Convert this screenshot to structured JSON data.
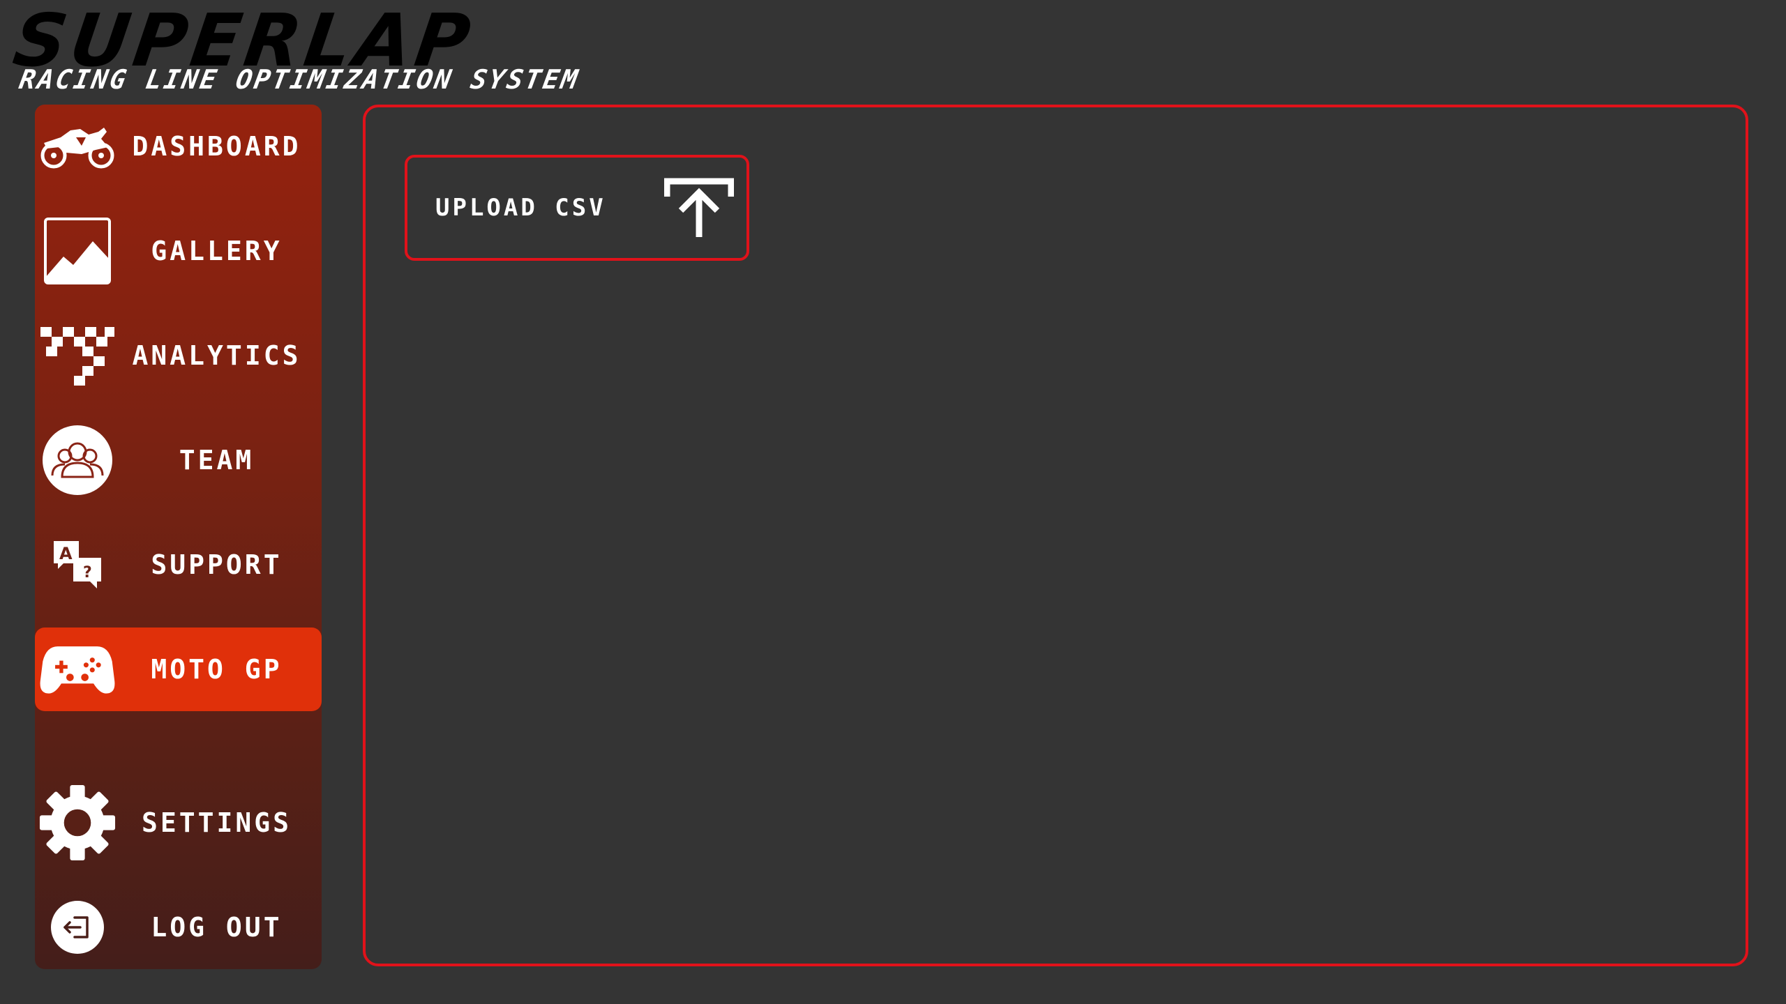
{
  "header": {
    "title": "SUPERLAP",
    "subtitle": "RACING LINE OPTIMIZATION SYSTEM"
  },
  "sidebar": {
    "items": [
      {
        "label": "DASHBOARD",
        "icon": "motorcycle-icon"
      },
      {
        "label": "GALLERY",
        "icon": "image-icon"
      },
      {
        "label": "ANALYTICS",
        "icon": "checkered-flag-icon"
      },
      {
        "label": "TEAM",
        "icon": "team-icon"
      },
      {
        "label": "SUPPORT",
        "icon": "translate-chat-icon"
      },
      {
        "label": "MOTO GP",
        "icon": "gamepad-icon",
        "active": true
      },
      {
        "label": "SETTINGS",
        "icon": "gear-icon"
      },
      {
        "label": "LOG OUT",
        "icon": "logout-icon"
      }
    ]
  },
  "main": {
    "upload_label": "UPLOAD CSV",
    "upload_icon": "upload-icon"
  },
  "colors": {
    "background": "#343434",
    "accent_red": "#e0121a",
    "active_item": "#e0300a",
    "sidebar_top": "#96220e",
    "sidebar_bottom": "#441e1a"
  }
}
